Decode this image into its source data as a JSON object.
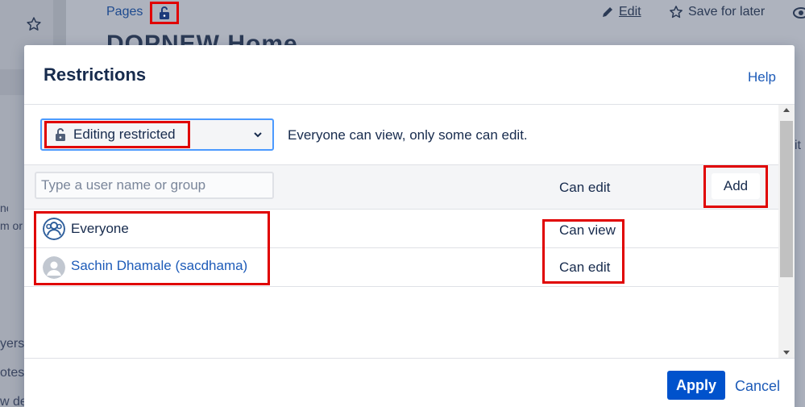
{
  "background": {
    "breadcrumb": "Pages",
    "page_title": "DOPNEW Home",
    "edit_label": "Edit",
    "save_for_later_label": "Save for later",
    "sidebar_fragments": [
      "ne",
      "m or",
      "yers",
      "otes",
      "w de"
    ],
    "right_fragment": "it"
  },
  "dialog": {
    "title": "Restrictions",
    "help_label": "Help",
    "mode_select": {
      "selected": "Editing restricted",
      "description": "Everyone can view, only some can edit."
    },
    "add_row": {
      "input_placeholder": "Type a user name or group",
      "permission": "Can edit",
      "add_label": "Add"
    },
    "entries": [
      {
        "name": "Everyone",
        "permission": "Can view",
        "avatar": "group-avatar-icon"
      },
      {
        "name": "Sachin Dhamale (sacdhama)",
        "permission": "Can edit",
        "avatar": "user-avatar-icon"
      }
    ],
    "footer": {
      "apply_label": "Apply",
      "cancel_label": "Cancel"
    }
  },
  "colors": {
    "primary": "#0052cc",
    "link": "#1d5bb8",
    "annotation_red": "#e00000",
    "overlay": "#aeb3be"
  }
}
